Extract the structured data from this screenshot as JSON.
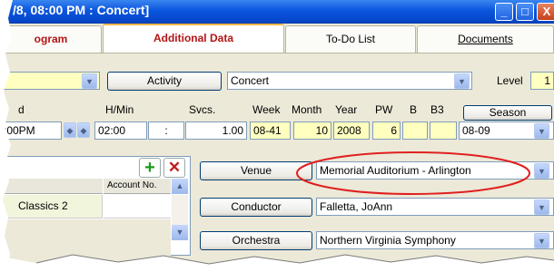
{
  "window": {
    "title": "/8, 08:00 PM : Concert]"
  },
  "window_buttons": {
    "minimize": "_",
    "maximize": "□",
    "close": "X"
  },
  "tabs": [
    {
      "label": "ogram"
    },
    {
      "label": "Additional Data"
    },
    {
      "label": "To-Do List"
    },
    {
      "label": "Documents"
    }
  ],
  "row1": {
    "activity_button": "Activity",
    "activity_value": "Concert",
    "level_label": "Level",
    "level_value": "1"
  },
  "schedule": {
    "headers": {
      "end": "d",
      "hmin": "H/Min",
      "svcs": "Svcs.",
      "week": "Week",
      "month": "Month",
      "year": "Year",
      "pw": "PW",
      "b": "B",
      "b3": "B3"
    },
    "season_button": "Season",
    "values": {
      "end_time": ":00PM",
      "hmin": "02:00",
      "colon": ":",
      "svcs": "1.00",
      "week": "08-41",
      "month": "10",
      "year": "2008",
      "pw": "6",
      "season": "08-09"
    }
  },
  "grid": {
    "header_account": "Account No.",
    "rows": [
      {
        "name": "Classics 2",
        "account": ""
      }
    ]
  },
  "venue": {
    "button": "Venue",
    "value": "Memorial Auditorium - Arlington"
  },
  "conductor": {
    "button": "Conductor",
    "value": "Falletta, JoAnn"
  },
  "orchestra": {
    "button": "Orchestra",
    "value": "Northern Virginia Symphony"
  },
  "icons": {
    "add": "green-plus-icon",
    "delete": "red-x-icon",
    "dropdown": "chevron-down-icon",
    "spin": "spinner-icon"
  },
  "colors": {
    "titlebar": "#0a55de",
    "annotation": "#e02020",
    "required_field": "#ffffc0",
    "active_tab_text": "#b41414"
  }
}
